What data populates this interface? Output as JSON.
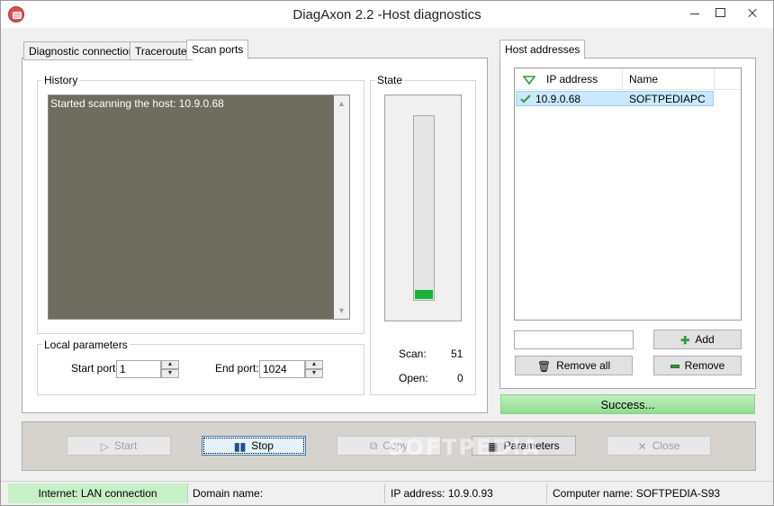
{
  "window": {
    "title": "DiagAxon 2.2 -Host diagnostics"
  },
  "tabs": [
    "Diagnostic connection",
    "Traceroute",
    "Scan ports"
  ],
  "history": {
    "label": "History",
    "text": "Started scanning the host: 10.9.0.68"
  },
  "state": {
    "label": "State",
    "progress_fraction": 0.05,
    "bar_color": "#19b33a",
    "scan_label": "Scan:",
    "scan_value": "51",
    "open_label": "Open:",
    "open_value": "0"
  },
  "local_params": {
    "label": "Local parameters",
    "start_port_label": "Start port:",
    "start_port_value": "1",
    "end_port_label": "End port:",
    "end_port_value": "1024"
  },
  "host_addresses": {
    "tab": "Host addresses",
    "columns": [
      "IP address",
      "Name"
    ],
    "rows": [
      {
        "ip": "10.9.0.68",
        "name": "SOFTPEDIAPC",
        "status_icon": "check-icon"
      }
    ],
    "input_value": "",
    "add_label": "Add",
    "remove_all_label": "Remove all",
    "remove_label": "Remove",
    "status": "Success..."
  },
  "actions": {
    "start": "Start",
    "stop": "Stop",
    "copy": "Copy",
    "parameters": "Parameters",
    "close": "Close"
  },
  "watermark": "SOFTPEDIA",
  "statusbar": {
    "internet": "Internet: LAN connection",
    "domain": "Domain name:",
    "ip": "IP address: 10.9.0.93",
    "computer": "Computer name: SOFTPEDIA-S93"
  },
  "colors": {
    "accent_success": "#8fdc8f",
    "selection": "#cce8ff",
    "history_bg": "#6f6c60"
  }
}
